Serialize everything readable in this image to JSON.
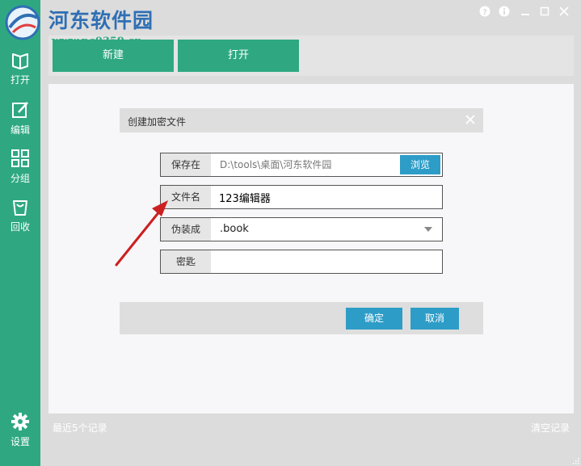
{
  "watermark": {
    "site_name": "河东软件园",
    "url": "www.pc0359.cn"
  },
  "sidebar": {
    "items": [
      {
        "label": "打开",
        "icon": "book-icon"
      },
      {
        "label": "编辑",
        "icon": "edit-icon"
      },
      {
        "label": "分组",
        "icon": "grid-icon"
      },
      {
        "label": "回收",
        "icon": "recycle-bin-icon"
      }
    ],
    "settings": {
      "label": "设置",
      "icon": "gear-icon"
    }
  },
  "window_controls": [
    "help-icon",
    "info-icon",
    "minimize-icon",
    "maximize-icon",
    "close-icon"
  ],
  "toolbar": {
    "new_label": "新建",
    "open_label": "打开"
  },
  "dialog": {
    "title": "创建加密文件",
    "fields": {
      "save_location": {
        "label": "保存在",
        "value": "D:\\tools\\桌面\\河东软件园",
        "button": "浏览"
      },
      "file_name": {
        "label": "文件名",
        "value": "123编辑器"
      },
      "disguise_as": {
        "label": "伪装成",
        "value": ".book"
      },
      "password": {
        "label": "密匙",
        "value": ""
      }
    },
    "confirm_label": "确定",
    "cancel_label": "取消"
  },
  "footer": {
    "recent": "最近5个记录",
    "clear": "清空记录"
  },
  "colors": {
    "sidebar_green": "#2fa882",
    "button_blue": "#2d9dc8",
    "annotation_red": "#cc1f1f"
  }
}
